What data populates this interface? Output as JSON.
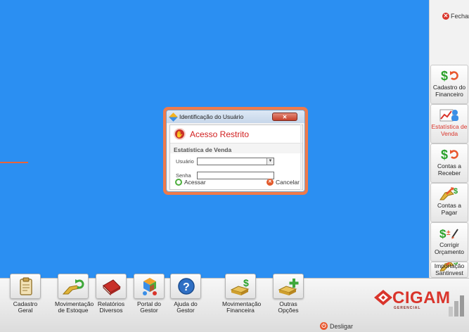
{
  "window": {
    "close_label": "Fechar"
  },
  "sidebar": {
    "items": [
      {
        "label": "Cadastro do Financeiro",
        "icon": "dollar-refresh-icon",
        "active": false
      },
      {
        "label": "Estatística de Venda",
        "icon": "chart-user-icon",
        "active": true
      },
      {
        "label": "Contas a Receber",
        "icon": "dollar-refresh-icon",
        "active": false
      },
      {
        "label": "Contas a Pagar",
        "icon": "hand-dollar-icon",
        "active": false
      },
      {
        "label": "Corrigir Orçamento",
        "icon": "dollar-plusminus-icon",
        "active": false
      },
      {
        "label": "Importação Santinvest",
        "icon": "hand-dollar-icon",
        "active": false
      }
    ]
  },
  "bottom": {
    "items": [
      {
        "label": "Cadastro Geral",
        "icon": "clipboard-icon"
      },
      {
        "label": "Movimentação de Estoque",
        "icon": "stock-refresh-icon"
      },
      {
        "label": "Relatórios Diversos",
        "icon": "book-icon"
      },
      {
        "label": "Portal do Gestor",
        "icon": "portal-cube-icon"
      },
      {
        "label": "Ajuda do Gestor",
        "icon": "help-icon"
      },
      {
        "label": "Movimentação Financeira",
        "icon": "box-dollar-icon"
      },
      {
        "label": "Outras Opções",
        "icon": "box-plus-icon"
      }
    ],
    "logout_label": "Desligar",
    "brand": "CIGAM",
    "brand_sub": "GERENCIAL"
  },
  "dialog": {
    "title": "Identificação do Usuário",
    "heading": "Acesso Restrito",
    "module": "Estatística de Venda",
    "user_label": "Usuário",
    "user_value": "",
    "password_label": "Senha",
    "password_value": "",
    "access_label": "Acessar",
    "cancel_label": "Cancelar"
  },
  "colors": {
    "desktop": "#2b8ff2",
    "accent": "#e8653a",
    "brand": "#d9342b"
  }
}
